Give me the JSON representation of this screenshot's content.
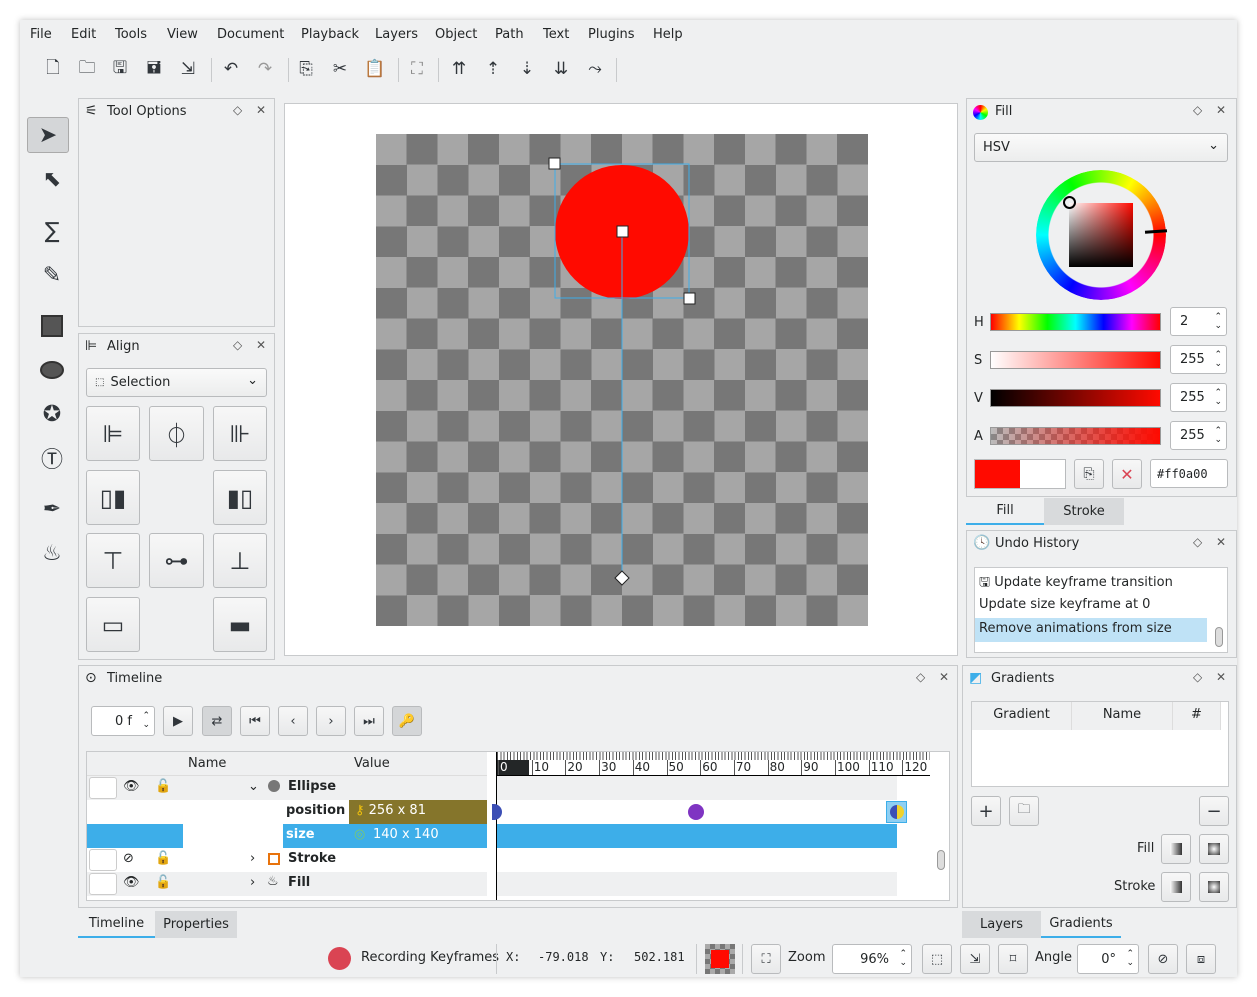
{
  "menu": [
    "File",
    "Edit",
    "Tools",
    "View",
    "Document",
    "Playback",
    "Layers",
    "Object",
    "Path",
    "Text",
    "Plugins",
    "Help"
  ],
  "toolbar": [
    "new-icon",
    "open-icon",
    "save-icon",
    "save-as-icon",
    "export-icon",
    "undo-icon",
    "redo-icon",
    "copy-icon",
    "cut-icon",
    "paste-icon",
    "group-icon",
    "raise-to-top-icon",
    "raise-icon",
    "lower-icon",
    "lower-to-bottom-icon",
    "object-to-path-icon"
  ],
  "tools": [
    "select-icon",
    "edit-nodes-icon",
    "draw-bezier-icon",
    "freehand-icon",
    "rectangle-icon",
    "ellipse-icon",
    "star-icon",
    "text-icon",
    "color-picker-icon",
    "fill-icon"
  ],
  "tool_options": {
    "title": "Tool Options"
  },
  "align": {
    "title": "Align",
    "relative_to": "Selection"
  },
  "fill_panel": {
    "title": "Fill",
    "mode": "HSV",
    "h_label": "H",
    "s_label": "S",
    "v_label": "V",
    "a_label": "A",
    "h": "2",
    "s": "255",
    "v": "255",
    "a": "255",
    "hex": "#ff0a00",
    "color": "#ff0a00",
    "tabs": [
      "Fill",
      "Stroke"
    ]
  },
  "undo": {
    "title": "Undo History",
    "items": [
      "Update keyframe transition",
      "Update size keyframe at 0",
      "Remove animations from size"
    ]
  },
  "timeline": {
    "title": "Timeline",
    "frame": "0 f",
    "col_name": "Name",
    "col_value": "Value",
    "ruler": [
      "0",
      "10",
      "20",
      "30",
      "40",
      "50",
      "60",
      "70",
      "80",
      "90",
      "100",
      "110",
      "120"
    ],
    "rows": [
      {
        "name": "Ellipse",
        "value": ""
      },
      {
        "name": "position",
        "value": "256 x 81"
      },
      {
        "name": "size",
        "value": "140 x 140"
      },
      {
        "name": "Stroke",
        "value": ""
      },
      {
        "name": "Fill",
        "value": ""
      }
    ]
  },
  "gradients": {
    "title": "Gradients",
    "cols": [
      "Gradient",
      "Name",
      "#"
    ],
    "fill_label": "Fill",
    "stroke_label": "Stroke"
  },
  "bottom_tabs_left": [
    "Timeline",
    "Properties"
  ],
  "bottom_tabs_right": [
    "Layers",
    "Gradients"
  ],
  "status": {
    "recording": "Recording Keyframes",
    "x_label": "X:",
    "x": "-79.018",
    "y_label": "Y:",
    "y": "502.181",
    "zoom_label": "Zoom",
    "zoom": "96%",
    "angle_label": "Angle",
    "angle": "0°"
  }
}
